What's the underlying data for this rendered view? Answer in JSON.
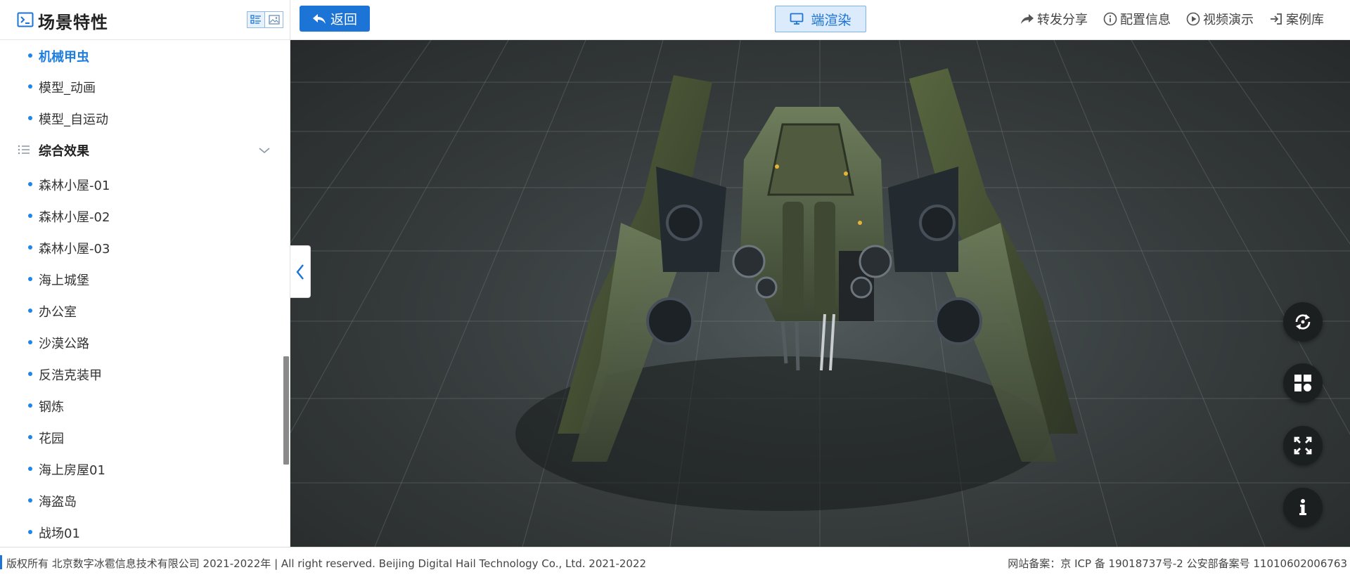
{
  "sidebar": {
    "title": "场景特性",
    "view_modes": [
      "list-view-icon",
      "image-view-icon"
    ],
    "items_top": [
      {
        "label": "机械甲虫",
        "active": true
      },
      {
        "label": "模型_动画"
      },
      {
        "label": "模型_自运动"
      }
    ],
    "group": {
      "label": "综合效果",
      "icon": "list-icon",
      "chevron": "chevron-down-icon"
    },
    "items": [
      {
        "label": "森林小屋-01"
      },
      {
        "label": "森林小屋-02"
      },
      {
        "label": "森林小屋-03"
      },
      {
        "label": "海上城堡"
      },
      {
        "label": "办公室"
      },
      {
        "label": "沙漠公路"
      },
      {
        "label": "反浩克装甲"
      },
      {
        "label": "钢炼"
      },
      {
        "label": "花园"
      },
      {
        "label": "海上房屋01"
      },
      {
        "label": "海盗岛"
      },
      {
        "label": "战场01"
      }
    ]
  },
  "topbar": {
    "back_label": "返回",
    "render_label": "端渲染",
    "actions": [
      {
        "label": "转发分享",
        "icon": "share-icon"
      },
      {
        "label": "配置信息",
        "icon": "info-circle-icon"
      },
      {
        "label": "视频演示",
        "icon": "play-circle-icon"
      },
      {
        "label": "案例库",
        "icon": "enter-icon"
      }
    ]
  },
  "viewport": {
    "tools": [
      "rotate-icon",
      "layout-icon",
      "fullscreen-icon",
      "info-icon"
    ]
  },
  "footer": {
    "copyright": "版权所有 北京数字冰雹信息技术有限公司 2021-2022年 | All right reserved. Beijing Digital Hail Technology Co., Ltd. 2021-2022",
    "icp": "网站备案：京 ICP 备 19018737号-2 公安部备案号 11010602006763"
  },
  "colors": {
    "accent": "#1b74d6",
    "active_text": "#1e7ee0",
    "render_bg": "#dcebfb",
    "viewport_bg": "#363b3c",
    "fab_bg": "#1c1f20"
  }
}
